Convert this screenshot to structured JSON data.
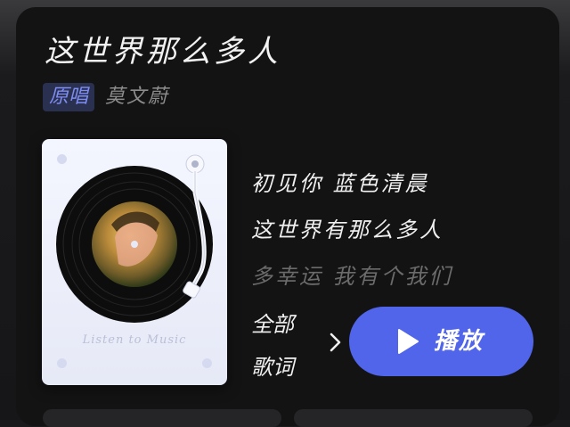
{
  "song": {
    "title": "这世界那么多人",
    "badge": "原唱",
    "artist": "莫文蔚"
  },
  "player": {
    "caption": "Listen to Music"
  },
  "lyrics": {
    "lines": [
      "初见你 蓝色清晨",
      "这世界有那么多人",
      "多幸运 我有个我们"
    ],
    "all_lyrics_line1": "全部",
    "all_lyrics_line2": "歌词"
  },
  "play_button": {
    "label": "播放"
  },
  "colors": {
    "accent": "#5065ea",
    "badge_text": "#7d8df2",
    "card_bg": "#131314"
  },
  "icons": [
    "play-icon",
    "chevron-right-icon"
  ]
}
